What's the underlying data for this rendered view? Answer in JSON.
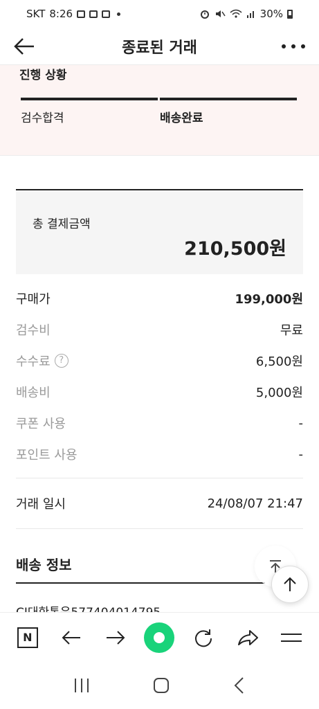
{
  "status_bar": {
    "carrier": "SKT",
    "time": "8:26",
    "battery": "30%"
  },
  "header": {
    "title": "종료된 거래"
  },
  "progress": {
    "title": "진행 상황",
    "steps": [
      {
        "label": "검수합격",
        "bold": false
      },
      {
        "label": "배송완료",
        "bold": true
      }
    ]
  },
  "payment": {
    "total_label": "총 결제금액",
    "total_value": "210,500원",
    "items": [
      {
        "label": "구매가",
        "value": "199,000원"
      },
      {
        "label": "검수비",
        "value": "무료"
      },
      {
        "label": "수수료",
        "value": "6,500원",
        "help": "?"
      },
      {
        "label": "배송비",
        "value": "5,000원"
      },
      {
        "label": "쿠폰 사용",
        "value": "-"
      },
      {
        "label": "포인트 사용",
        "value": "-"
      }
    ],
    "trade_date_label": "거래 일시",
    "trade_date_value": "24/08/07 21:47"
  },
  "delivery": {
    "title": "배송 정보",
    "partial_text": "CJ대한통운577404014795"
  },
  "colors": {
    "progress_bg": "#fdf4f3",
    "total_bg": "#f5f5f5",
    "browser_accent": "#19d37a"
  },
  "icons": {
    "back": "arrow-left-icon",
    "more": "more-dots-icon",
    "help": "question-circle-icon",
    "scroll_top_faded": "scroll-to-top-icon",
    "scroll_up": "arrow-up-icon",
    "browser": [
      "naver-n-icon",
      "arrow-left-icon",
      "arrow-right-icon",
      "green-home-icon",
      "refresh-icon",
      "share-icon",
      "menu-icon"
    ],
    "android": [
      "recent-apps-icon",
      "home-icon",
      "back-icon"
    ]
  }
}
